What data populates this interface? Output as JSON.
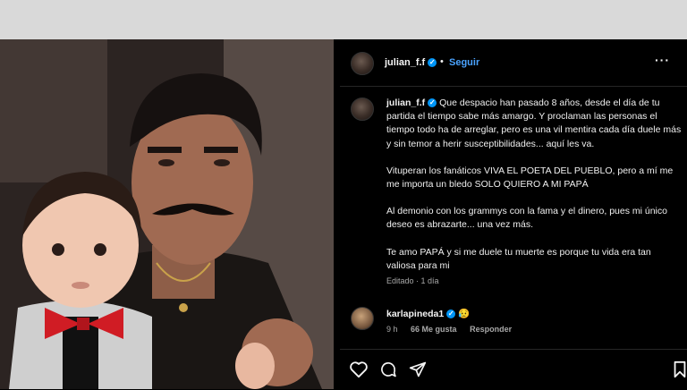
{
  "post": {
    "username": "julian_f.f",
    "follow_label": "Seguir",
    "separator": "•",
    "caption": {
      "p1": "Que despacio han pasado 8 años, desde el día de tu partida el tiempo sabe más amargo. Y proclaman las personas el tiempo todo ha de arreglar, pero es una vil mentira cada día duele más y sin temor a herir susceptibilidades... aquí les va.",
      "p2": "Vituperan los fanáticos VIVA EL POETA DEL PUEBLO, pero a mí me me importa un bledo SOLO QUIERO A MI PAPÁ",
      "p3": "Al demonio con los grammys con la fama y el dinero, pues mi único deseo es abrazarte... una vez más.",
      "p4": "Te amo PAPÁ y si me duele tu muerte es porque tu vida era tan valiosa para mi"
    },
    "edited_label": "Editado · 1 día"
  },
  "comment": {
    "username": "karlapineda1",
    "emoji": "😥",
    "time": "9 h",
    "likes": "66 Me gusta",
    "reply_label": "Responder"
  },
  "icons": {
    "verified": "verified-badge",
    "more": "more-options-icon",
    "like": "heart-icon",
    "comment": "comment-icon",
    "share": "share-icon",
    "save": "bookmark-icon"
  },
  "colors": {
    "accent": "#0095f6",
    "follow": "#4aa3ff",
    "background": "#000000",
    "top_bar": "#d9d9d9"
  }
}
